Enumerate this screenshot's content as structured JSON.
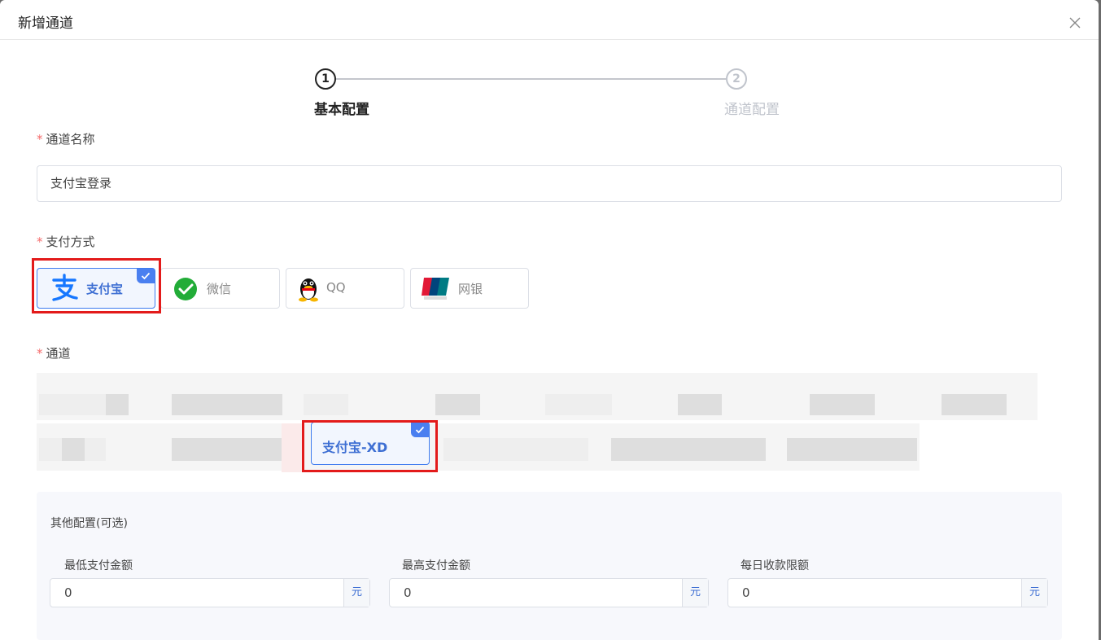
{
  "dialog": {
    "title": "新增通道",
    "close_icon": "close-icon"
  },
  "steps": [
    {
      "number": "1",
      "label": "基本配置",
      "active": true
    },
    {
      "number": "2",
      "label": "通道配置",
      "active": false
    }
  ],
  "fields": {
    "channel_name_label": "通道名称",
    "channel_name_value": "支付宝登录",
    "payment_method_label": "支付方式",
    "channel_label": "通道",
    "required_mark": "*"
  },
  "payment_methods": [
    {
      "label": "支付宝",
      "icon": "alipay-icon",
      "selected": true
    },
    {
      "label": "微信",
      "icon": "wechat-icon",
      "selected": false
    },
    {
      "label": "QQ",
      "icon": "qq-penguin-icon",
      "selected": false
    },
    {
      "label": "网银",
      "icon": "unionpay-icon",
      "selected": false
    }
  ],
  "channels": {
    "selected_label": "支付宝-XD"
  },
  "other_config": {
    "title": "其他配置(可选)",
    "fields": [
      {
        "label": "最低支付金额",
        "value": "0",
        "unit": "元"
      },
      {
        "label": "最高支付金额",
        "value": "0",
        "unit": "元"
      },
      {
        "label": "每日收款限额",
        "value": "0",
        "unit": "元"
      }
    ]
  },
  "colors": {
    "accent": "#3e7bef",
    "highlight_box": "#e31b1b",
    "required": "#f56c6c"
  }
}
